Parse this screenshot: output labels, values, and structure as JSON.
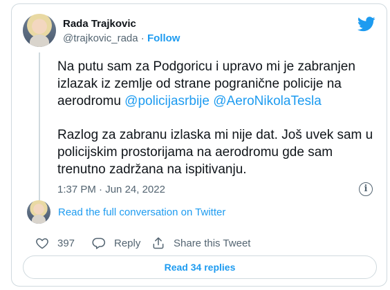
{
  "author": {
    "name": "Rada Trajkovic",
    "handle": "@trajkovic_rada",
    "separator": "·",
    "follow_label": "Follow"
  },
  "tweet": {
    "paragraph1_text": "Na putu sam za Podgoricu i upravo mi je zabranjen izlazak iz zemlje od strane pogranične policije na aerodromu ",
    "mention1": "@policijasrbije",
    "mention2": "@AeroNikolaTesla",
    "paragraph2": "Razlog za zabranu izlaska mi nije dat. Još uvek sam u policijskim prostorijama na aerodromu gde sam trenutno zadržana na ispitivanju."
  },
  "meta": {
    "time": "1:37 PM",
    "separator": "·",
    "date": "Jun 24, 2022",
    "info_icon": "i"
  },
  "conversation": {
    "link_label": "Read the full conversation on Twitter"
  },
  "actions": {
    "like_count": "397",
    "reply_label": "Reply",
    "share_label": "Share this Tweet"
  },
  "read_replies_label": "Read 34 replies",
  "colors": {
    "accent": "#1d9bf0",
    "text": "#0f1419",
    "muted": "#536471",
    "border": "#cfd9de"
  },
  "icons": [
    "twitter-bird-icon",
    "info-icon",
    "heart-icon",
    "reply-icon",
    "share-icon"
  ]
}
